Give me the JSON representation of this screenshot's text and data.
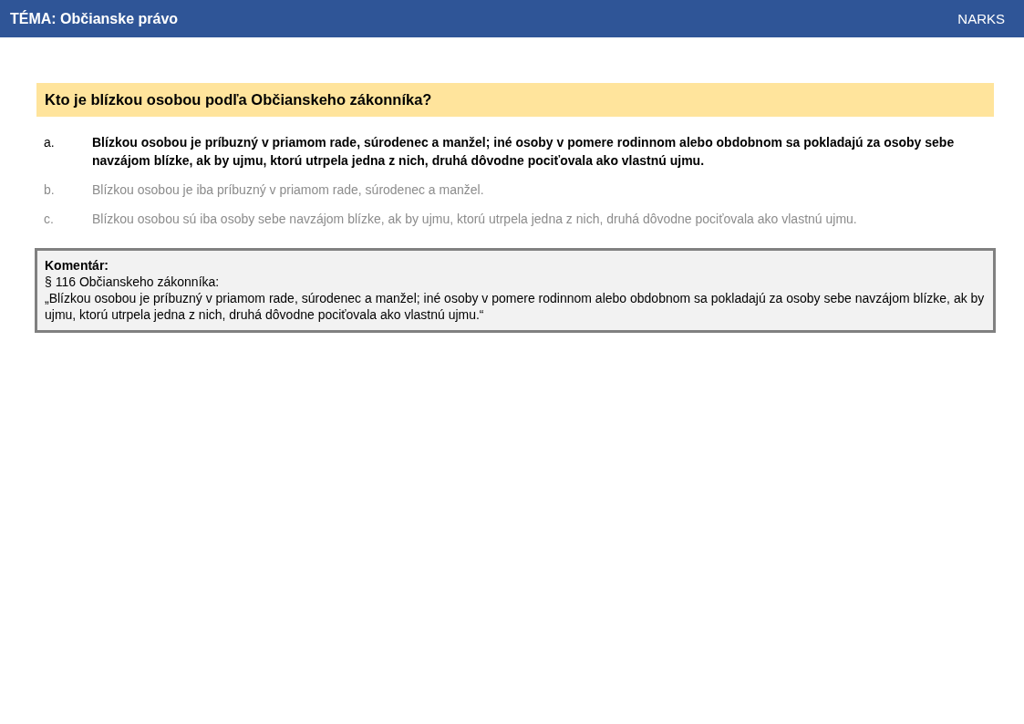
{
  "header": {
    "topic": "TÉMA: Občianske právo",
    "brand": "NARKS"
  },
  "question": "Kto je blízkou osobou podľa Občianskeho zákonníka?",
  "answers": [
    {
      "letter": "a.",
      "text": "Blízkou osobou je príbuzný v priamom rade, súrodenec a manžel; iné osoby v pomere rodinnom alebo obdobnom sa pokladajú za osoby sebe navzájom blízke, ak by ujmu, ktorú utrpela jedna z nich, druhá dôvodne pociťovala ako vlastnú ujmu.",
      "correct": true
    },
    {
      "letter": "b.",
      "text": "Blízkou osobou je iba príbuzný v priamom rade, súrodenec a manžel.",
      "correct": false
    },
    {
      "letter": "c.",
      "text": "Blízkou osobou sú iba osoby sebe navzájom blízke, ak by ujmu, ktorú utrpela jedna z nich, druhá dôvodne pociťovala ako vlastnú ujmu.",
      "correct": false
    }
  ],
  "comment": {
    "title": "Komentár:",
    "source": "§ 116 Občianskeho zákonníka:",
    "quote": "„Blízkou osobou je príbuzný v priamom rade, súrodenec a manžel; iné osoby v pomere rodinnom alebo obdobnom sa pokladajú za osoby sebe navzájom blízke, ak by ujmu, ktorú utrpela jedna z nich, druhá dôvodne pociťovala ako vlastnú ujmu.“"
  }
}
